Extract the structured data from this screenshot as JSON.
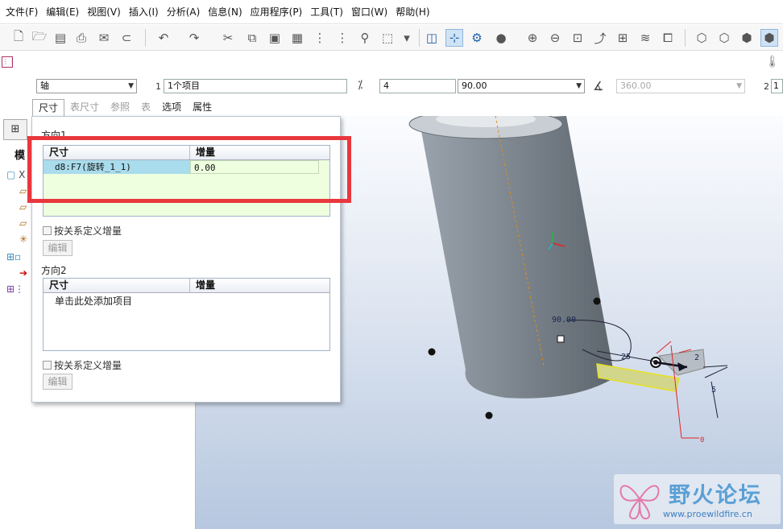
{
  "menubar": {
    "items": [
      "文件(F)",
      "编辑(E)",
      "视图(V)",
      "插入(I)",
      "分析(A)",
      "信息(N)",
      "应用程序(P)",
      "工具(T)",
      "窗口(W)",
      "帮助(H)"
    ]
  },
  "toolbar": {
    "icons": [
      "new-icon",
      "open-icon",
      "save-icon",
      "print-icon",
      "email-icon",
      "link-icon",
      "undo-icon",
      "redo-icon",
      "cut-icon",
      "copy-icon",
      "paste-icon",
      "paste-special-icon",
      "regenerate-icon",
      "regenerate-manager-icon",
      "find-icon",
      "select-box-icon",
      "select-dropdown-icon",
      "csys-display-icon",
      "spin-center-icon",
      "orient-icon",
      "appearance-icon",
      "zoom-in-icon",
      "zoom-out-icon",
      "refit-icon",
      "reorient-icon",
      "view-manager-icon",
      "layers-icon",
      "model-display-icon",
      "wireframe-icon",
      "hidden-line-icon",
      "no-hidden-icon",
      "shading-icon"
    ]
  },
  "dashboard": {
    "pattern_type": "轴",
    "ref_index": "1",
    "ref_selection": "1个项目",
    "count": "4",
    "angle_value": "90.00",
    "extent_value": "360.00",
    "second_index": "2",
    "second_count": "1",
    "tabs": [
      {
        "label": "尺寸",
        "state": "selected"
      },
      {
        "label": "表尺寸",
        "state": "disabled"
      },
      {
        "label": "参照",
        "state": "disabled"
      },
      {
        "label": "表",
        "state": "disabled"
      },
      {
        "label": "选项",
        "state": "normal"
      },
      {
        "label": "属性",
        "state": "normal"
      }
    ]
  },
  "left_panel": {
    "title": "模",
    "tree_first": "X"
  },
  "popup": {
    "direction1": {
      "label": "方向1",
      "columns": [
        "尺寸",
        "增量"
      ],
      "rows": [
        {
          "dimension": "d8:F7(旋转_1_1)",
          "increment": "0.00"
        }
      ],
      "checkbox_label": "按关系定义增量",
      "edit_label": "编辑"
    },
    "direction2": {
      "label": "方向2",
      "columns": [
        "尺寸",
        "增量"
      ],
      "placeholder": "单击此处添加项目",
      "checkbox_label": "按关系定义增量",
      "edit_label": "编辑"
    }
  },
  "viewport": {
    "angle_dim_label": "90.00",
    "dim_25": "25",
    "dim_2": "2",
    "dim_5": "5",
    "dim_0": "0"
  },
  "watermark": {
    "title": "野火论坛",
    "url": "www.proewildfire.cn"
  },
  "colors": {
    "highlight_red": "#e8373d",
    "table_selected_cell": "#a9dcec",
    "table_area_green": "#eeffe0",
    "viewport_gradient_top": "#fbfcfe",
    "viewport_gradient_bottom": "#b6c7df"
  }
}
